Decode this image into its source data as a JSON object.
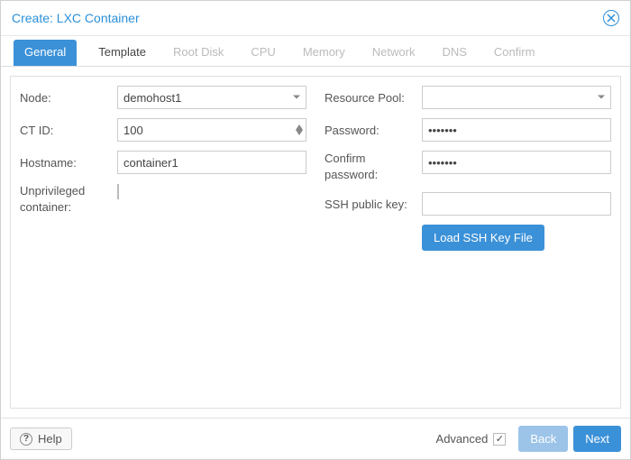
{
  "title": "Create: LXC Container",
  "tabs": [
    {
      "label": "General",
      "state": "active"
    },
    {
      "label": "Template",
      "state": "enabled"
    },
    {
      "label": "Root Disk",
      "state": "disabled"
    },
    {
      "label": "CPU",
      "state": "disabled"
    },
    {
      "label": "Memory",
      "state": "disabled"
    },
    {
      "label": "Network",
      "state": "disabled"
    },
    {
      "label": "DNS",
      "state": "disabled"
    },
    {
      "label": "Confirm",
      "state": "disabled"
    }
  ],
  "left": {
    "node_label": "Node:",
    "node_value": "demohost1",
    "ctid_label": "CT ID:",
    "ctid_value": "100",
    "hostname_label": "Hostname:",
    "hostname_value": "container1",
    "unpriv_label": "Unprivileged container:",
    "unpriv_checked": false
  },
  "right": {
    "pool_label": "Resource Pool:",
    "pool_value": "",
    "password_label": "Password:",
    "password_value": "•••••••",
    "confirm_label": "Confirm password:",
    "confirm_value": "•••••••",
    "sshkey_label": "SSH public key:",
    "sshkey_value": "",
    "sshbtn_label": "Load SSH Key File"
  },
  "bottom": {
    "help_label": "Help",
    "advanced_label": "Advanced",
    "advanced_checked": true,
    "back_label": "Back",
    "next_label": "Next"
  }
}
